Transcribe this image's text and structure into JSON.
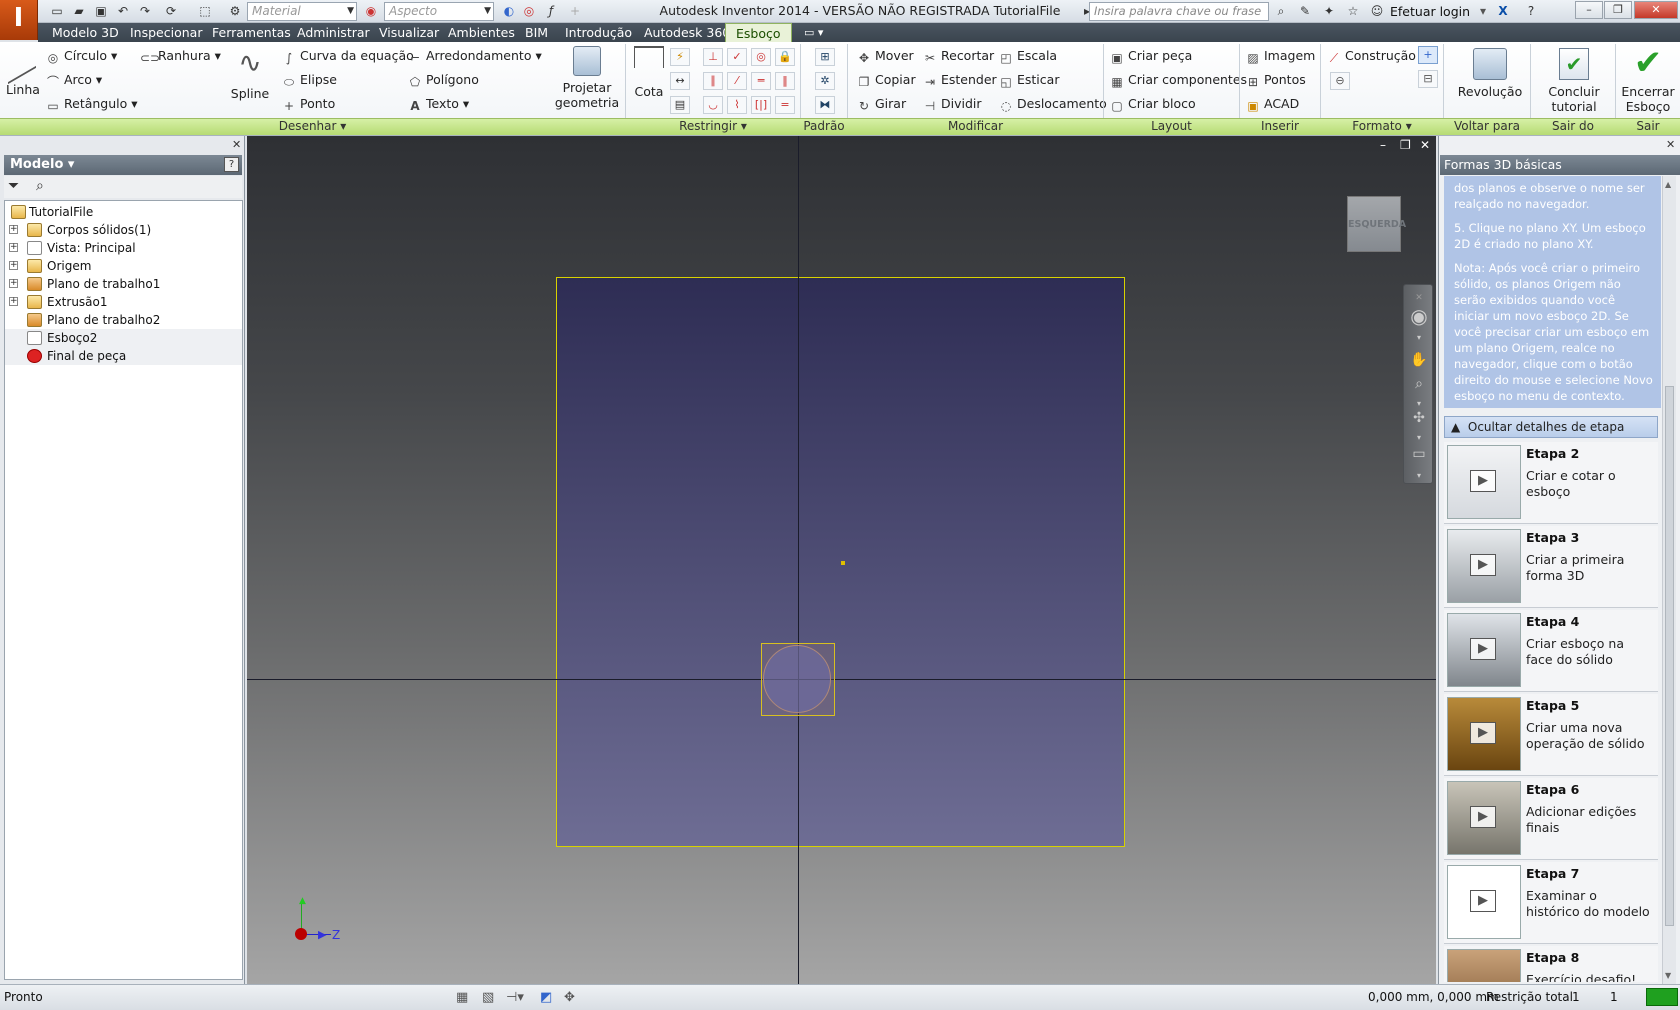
{
  "app": {
    "logo": "I",
    "title": "Autodesk Inventor 2014 - VERSÃO NÃO REGISTRADA   TutorialFile",
    "material_placeholder": "Material",
    "aspect_placeholder": "Aspecto",
    "search_placeholder": "Insira palavra chave ou frase",
    "login_label": "Efetuar login"
  },
  "menu_tabs": [
    "Modelo 3D",
    "Inspecionar",
    "Ferramentas",
    "Administrar",
    "Visualizar",
    "Ambientes",
    "BIM",
    "Introdução",
    "Autodesk 360",
    "Esboço"
  ],
  "active_tab": "Esboço",
  "ribbon": {
    "draw": {
      "linha": "Linha",
      "circulo": "Círculo",
      "arco": "Arco",
      "retangulo": "Retângulo",
      "ranhura": "Ranhura",
      "spline": "Spline",
      "curva": "Curva da equação",
      "elipse": "Elipse",
      "ponto": "Ponto",
      "arredondamento": "Arredondamento",
      "poligono": "Polígono",
      "texto": "Texto",
      "projetar": "Projetar geometria"
    },
    "constrain": {
      "cota": "Cota"
    },
    "modify": {
      "mover": "Mover",
      "copiar": "Copiar",
      "girar": "Girar",
      "recortar": "Recortar",
      "estender": "Estender",
      "dividir": "Dividir",
      "escala": "Escala",
      "esticar": "Esticar",
      "deslocamento": "Deslocamento"
    },
    "layout": {
      "criar_peca": "Criar peça",
      "criar_comp": "Criar componentes",
      "criar_bloco": "Criar bloco"
    },
    "insert": {
      "imagem": "Imagem",
      "pontos": "Pontos",
      "acad": "ACAD"
    },
    "format": {
      "construcao": "Construção"
    },
    "revolucao": "Revolução",
    "concluir": "Concluir tutorial",
    "encerrar": "Encerrar Esboço",
    "groups": {
      "desenhar": "Desenhar",
      "restringir": "Restringir",
      "padrao": "Padrão",
      "modificar": "Modificar",
      "layout": "Layout",
      "inserir": "Inserir",
      "formato": "Formato",
      "voltar3d": "Voltar para 3D",
      "sair_tutorial": "Sair do tutorial",
      "sair": "Sair"
    }
  },
  "browser": {
    "title": "Modelo",
    "items": [
      {
        "label": "TutorialFile",
        "expander": false
      },
      {
        "label": "Corpos sólidos(1)",
        "expander": true
      },
      {
        "label": "Vista: Principal",
        "expander": true
      },
      {
        "label": "Origem",
        "expander": true
      },
      {
        "label": "Plano de trabalho1",
        "expander": true
      },
      {
        "label": "Extrusão1",
        "expander": true
      },
      {
        "label": "Plano de trabalho2",
        "expander": false
      },
      {
        "label": "Esboço2",
        "expander": false
      },
      {
        "label": "Final de peça",
        "expander": false
      }
    ]
  },
  "viewport": {
    "viewcube_label": "ESQUERDA",
    "axis_z": "Z"
  },
  "tutorial": {
    "title": "Formas 3D básicas",
    "info": [
      "dos planos e observe o nome ser realçado no navegador.",
      "5. Clique no plano XY. Um esboço 2D é criado no plano XY.",
      "Nota: Após você criar o primeiro sólido, os planos Origem não serão exibidos quando você iniciar um novo esboço 2D. Se você precisar criar um esboço em um plano Origem, realce no navegador, clique com o botão direito do mouse e selecione Novo esboço no menu de contexto."
    ],
    "hide_details": "Ocultar detalhes de etapa",
    "steps": [
      {
        "title": "Etapa 2",
        "desc": "Criar e cotar o esboço"
      },
      {
        "title": "Etapa 3",
        "desc": "Criar a primeira forma 3D"
      },
      {
        "title": "Etapa 4",
        "desc": "Criar esboço na face do sólido"
      },
      {
        "title": "Etapa 5",
        "desc": "Criar uma nova operação de sólido"
      },
      {
        "title": "Etapa 6",
        "desc": "Adicionar edições finais"
      },
      {
        "title": "Etapa 7",
        "desc": "Examinar o histórico do modelo"
      },
      {
        "title": "Etapa 8",
        "desc": "Exercício desafio!"
      }
    ]
  },
  "status": {
    "left": "Pronto",
    "coords": "0,000 mm, 0,000 mm",
    "constraint": "Restrição total",
    "n1": "1",
    "n2": "1"
  }
}
